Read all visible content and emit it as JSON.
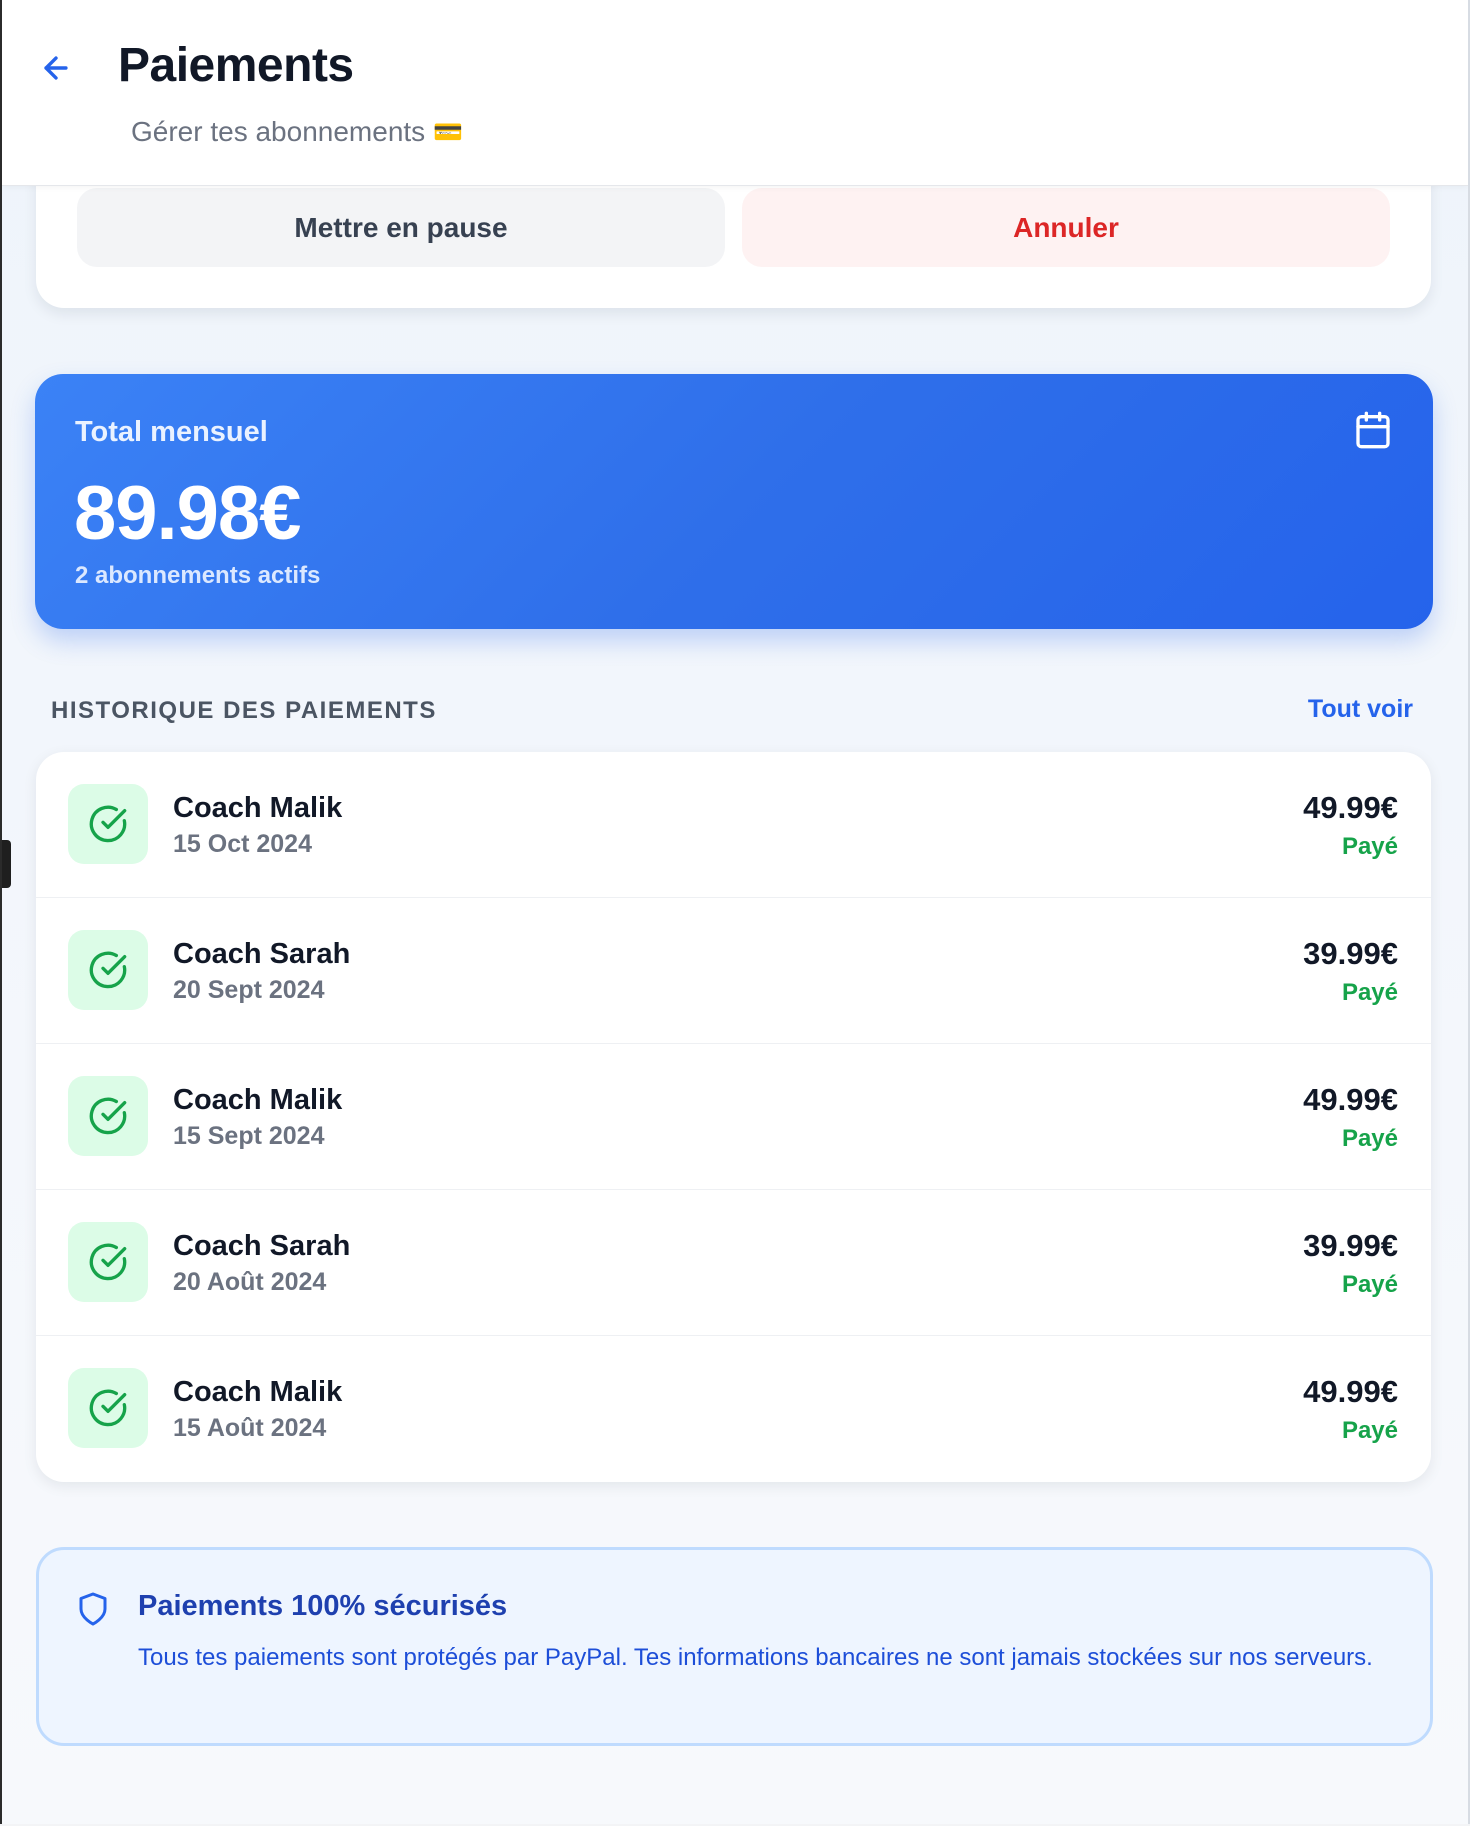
{
  "header": {
    "title": "Paiements",
    "subtitle": "Gérer tes abonnements",
    "subtitle_emoji": "💳"
  },
  "subscription_actions": {
    "pause_label": "Mettre en pause",
    "cancel_label": "Annuler"
  },
  "summary": {
    "label": "Total mensuel",
    "amount": "89.98€",
    "active_count": "2 abonnements actifs"
  },
  "history": {
    "title": "HISTORIQUE DES PAIEMENTS",
    "see_all": "Tout voir",
    "items": [
      {
        "name": "Coach Malik",
        "date": "15 Oct 2024",
        "amount": "49.99€",
        "status": "Payé"
      },
      {
        "name": "Coach Sarah",
        "date": "20 Sept 2024",
        "amount": "39.99€",
        "status": "Payé"
      },
      {
        "name": "Coach Malik",
        "date": "15 Sept 2024",
        "amount": "49.99€",
        "status": "Payé"
      },
      {
        "name": "Coach Sarah",
        "date": "20 Août 2024",
        "amount": "39.99€",
        "status": "Payé"
      },
      {
        "name": "Coach Malik",
        "date": "15 Août 2024",
        "amount": "49.99€",
        "status": "Payé"
      }
    ]
  },
  "security": {
    "title": "Paiements 100% sécurisés",
    "text": "Tous tes paiements sont protégés par PayPal. Tes informations bancaires ne sont jamais stockées sur nos serveurs."
  },
  "colors": {
    "accent": "#2563eb",
    "danger": "#dc2626",
    "success": "#16a34a"
  }
}
